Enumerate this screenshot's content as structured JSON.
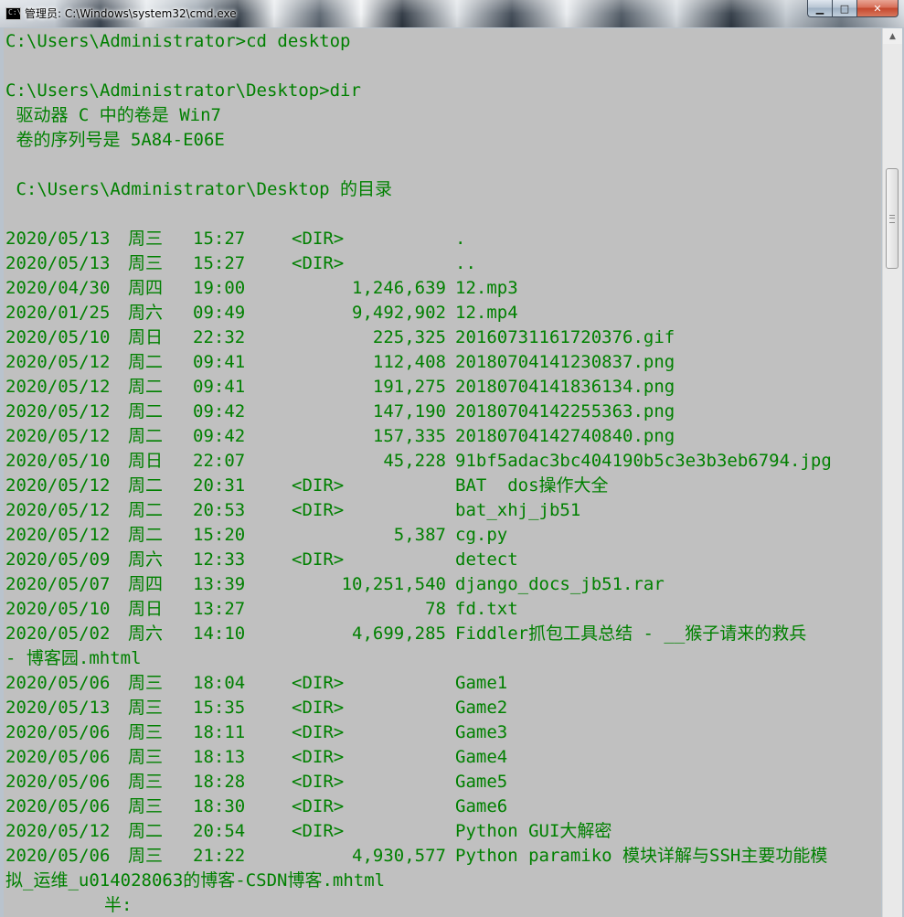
{
  "window": {
    "title": "管理员: C:\\Windows\\system32\\cmd.exe",
    "icon": "cmd-icon",
    "icon_text": "C:\\",
    "minimize_label": "▁",
    "maximize_label": "□",
    "close_label": "✕"
  },
  "console": {
    "text_color": "#008000",
    "background": "#c0c0c0",
    "lines_top": [
      "C:\\Users\\Administrator>cd desktop",
      "",
      "C:\\Users\\Administrator\\Desktop>dir",
      " 驱动器 C 中的卷是 Win7",
      " 卷的序列号是 5A84-E06E",
      "",
      " C:\\Users\\Administrator\\Desktop 的目录",
      ""
    ],
    "entries": [
      {
        "date": "2020/05/13",
        "weekday": "周三",
        "time": "15:27",
        "dir": "<DIR>",
        "size": "",
        "name": "."
      },
      {
        "date": "2020/05/13",
        "weekday": "周三",
        "time": "15:27",
        "dir": "<DIR>",
        "size": "",
        "name": ".."
      },
      {
        "date": "2020/04/30",
        "weekday": "周四",
        "time": "19:00",
        "dir": "",
        "size": "1,246,639",
        "name": "12.mp3"
      },
      {
        "date": "2020/01/25",
        "weekday": "周六",
        "time": "09:49",
        "dir": "",
        "size": "9,492,902",
        "name": "12.mp4"
      },
      {
        "date": "2020/05/10",
        "weekday": "周日",
        "time": "22:32",
        "dir": "",
        "size": "225,325",
        "name": "20160731161720376.gif"
      },
      {
        "date": "2020/05/12",
        "weekday": "周二",
        "time": "09:41",
        "dir": "",
        "size": "112,408",
        "name": "20180704141230837.png"
      },
      {
        "date": "2020/05/12",
        "weekday": "周二",
        "time": "09:41",
        "dir": "",
        "size": "191,275",
        "name": "20180704141836134.png"
      },
      {
        "date": "2020/05/12",
        "weekday": "周二",
        "time": "09:42",
        "dir": "",
        "size": "147,190",
        "name": "20180704142255363.png"
      },
      {
        "date": "2020/05/12",
        "weekday": "周二",
        "time": "09:42",
        "dir": "",
        "size": "157,335",
        "name": "20180704142740840.png"
      },
      {
        "date": "2020/05/10",
        "weekday": "周日",
        "time": "22:07",
        "dir": "",
        "size": "45,228",
        "name": "91bf5adac3bc404190b5c3e3b3eb6794.jpg"
      },
      {
        "date": "2020/05/12",
        "weekday": "周二",
        "time": "20:31",
        "dir": "<DIR>",
        "size": "",
        "name": "BAT  dos操作大全"
      },
      {
        "date": "2020/05/12",
        "weekday": "周二",
        "time": "20:53",
        "dir": "<DIR>",
        "size": "",
        "name": "bat_xhj_jb51"
      },
      {
        "date": "2020/05/12",
        "weekday": "周二",
        "time": "15:20",
        "dir": "",
        "size": "5,387",
        "name": "cg.py"
      },
      {
        "date": "2020/05/09",
        "weekday": "周六",
        "time": "12:33",
        "dir": "<DIR>",
        "size": "",
        "name": "detect"
      },
      {
        "date": "2020/05/07",
        "weekday": "周四",
        "time": "13:39",
        "dir": "",
        "size": "10,251,540",
        "name": "django_docs_jb51.rar"
      },
      {
        "date": "2020/05/10",
        "weekday": "周日",
        "time": "13:27",
        "dir": "",
        "size": "78",
        "name": "fd.txt"
      },
      {
        "date": "2020/05/02",
        "weekday": "周六",
        "time": "14:10",
        "dir": "",
        "size": "4,699,285",
        "name": "Fiddler抓包工具总结 - __猴子请来的救兵",
        "wrap": "- 博客园.mhtml"
      },
      {
        "date": "2020/05/06",
        "weekday": "周三",
        "time": "18:04",
        "dir": "<DIR>",
        "size": "",
        "name": "Game1"
      },
      {
        "date": "2020/05/13",
        "weekday": "周三",
        "time": "15:35",
        "dir": "<DIR>",
        "size": "",
        "name": "Game2"
      },
      {
        "date": "2020/05/06",
        "weekday": "周三",
        "time": "18:11",
        "dir": "<DIR>",
        "size": "",
        "name": "Game3"
      },
      {
        "date": "2020/05/06",
        "weekday": "周三",
        "time": "18:13",
        "dir": "<DIR>",
        "size": "",
        "name": "Game4"
      },
      {
        "date": "2020/05/06",
        "weekday": "周三",
        "time": "18:28",
        "dir": "<DIR>",
        "size": "",
        "name": "Game5"
      },
      {
        "date": "2020/05/06",
        "weekday": "周三",
        "time": "18:30",
        "dir": "<DIR>",
        "size": "",
        "name": "Game6"
      },
      {
        "date": "2020/05/12",
        "weekday": "周二",
        "time": "20:54",
        "dir": "<DIR>",
        "size": "",
        "name": "Python GUI大解密"
      },
      {
        "date": "2020/05/06",
        "weekday": "周三",
        "time": "21:22",
        "dir": "",
        "size": "4,930,577",
        "name": "Python paramiko 模块详解与SSH主要功能模",
        "wrap": "拟_运维_u014028063的博客-CSDN博客.mhtml"
      }
    ],
    "ime_status": "半:"
  },
  "scrollbar": {
    "up_arrow": "▲"
  }
}
